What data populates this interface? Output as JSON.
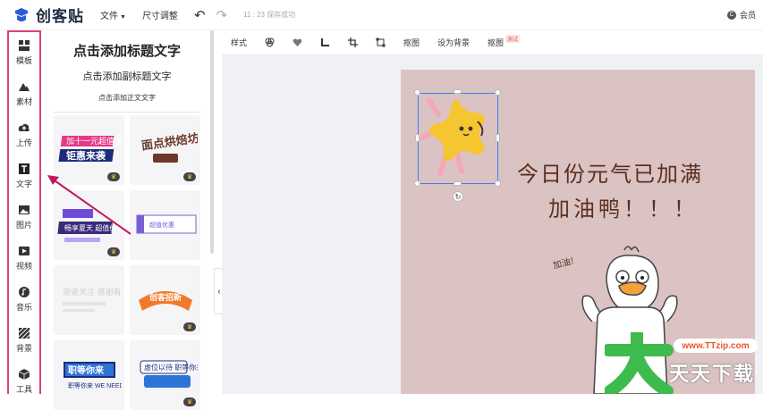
{
  "app": {
    "name": "创客贴"
  },
  "topbar": {
    "file_menu": "文件",
    "resize_menu": "尺寸调整",
    "save_status": "11 : 23 保存成功",
    "user_label": "会员",
    "user_icon_char": "C"
  },
  "sidebar": {
    "items": [
      {
        "label": "模板",
        "icon": "template-icon"
      },
      {
        "label": "素材",
        "icon": "material-icon"
      },
      {
        "label": "上传",
        "icon": "upload-icon"
      },
      {
        "label": "文字",
        "icon": "text-icon"
      },
      {
        "label": "图片",
        "icon": "image-icon"
      },
      {
        "label": "视频",
        "icon": "video-icon"
      },
      {
        "label": "音乐",
        "icon": "music-icon"
      },
      {
        "label": "背景",
        "icon": "background-icon"
      },
      {
        "label": "工具",
        "icon": "tools-icon"
      }
    ],
    "highlight_color": "#e0407a"
  },
  "text_panel": {
    "add_title": "点击添加标题文字",
    "add_subtitle": "点击添加副标题文字",
    "add_body": "点击添加正文文字",
    "templates": [
      {
        "text": "加十一元超值 钜惠来袭",
        "premium": true
      },
      {
        "text": "面点烘焙坊",
        "premium": true
      },
      {
        "text": "畅享夏天 超值价格",
        "premium": true
      },
      {
        "text": "超值优惠",
        "premium": false
      },
      {
        "text": "谢谢关注 感谢有你",
        "premium": false
      },
      {
        "text": "创客招新",
        "premium": true
      },
      {
        "text": "职等你来 WE NEED YOU",
        "premium": false
      },
      {
        "text": "虚位以待 职等你来",
        "premium": true
      }
    ]
  },
  "toolbar": {
    "items": [
      "样式",
      "",
      "",
      "",
      "",
      "",
      "抠图",
      "设为背景",
      "抠图"
    ],
    "labels": {
      "style": "样式",
      "matting": "抠图",
      "set_background": "设为背景",
      "cutout": "抠图",
      "beta": "测试"
    }
  },
  "canvas": {
    "line1": "今日份元气已加满",
    "line2": "加油鸭！！！",
    "duck_caption": "加油!",
    "background_color": "#dbc3c3"
  },
  "watermark": {
    "url": "www.TTzip.com",
    "text": "天天下载"
  },
  "colors": {
    "selection": "#3c7ef0",
    "headline": "#5b2f20",
    "star": "#f5c630"
  }
}
